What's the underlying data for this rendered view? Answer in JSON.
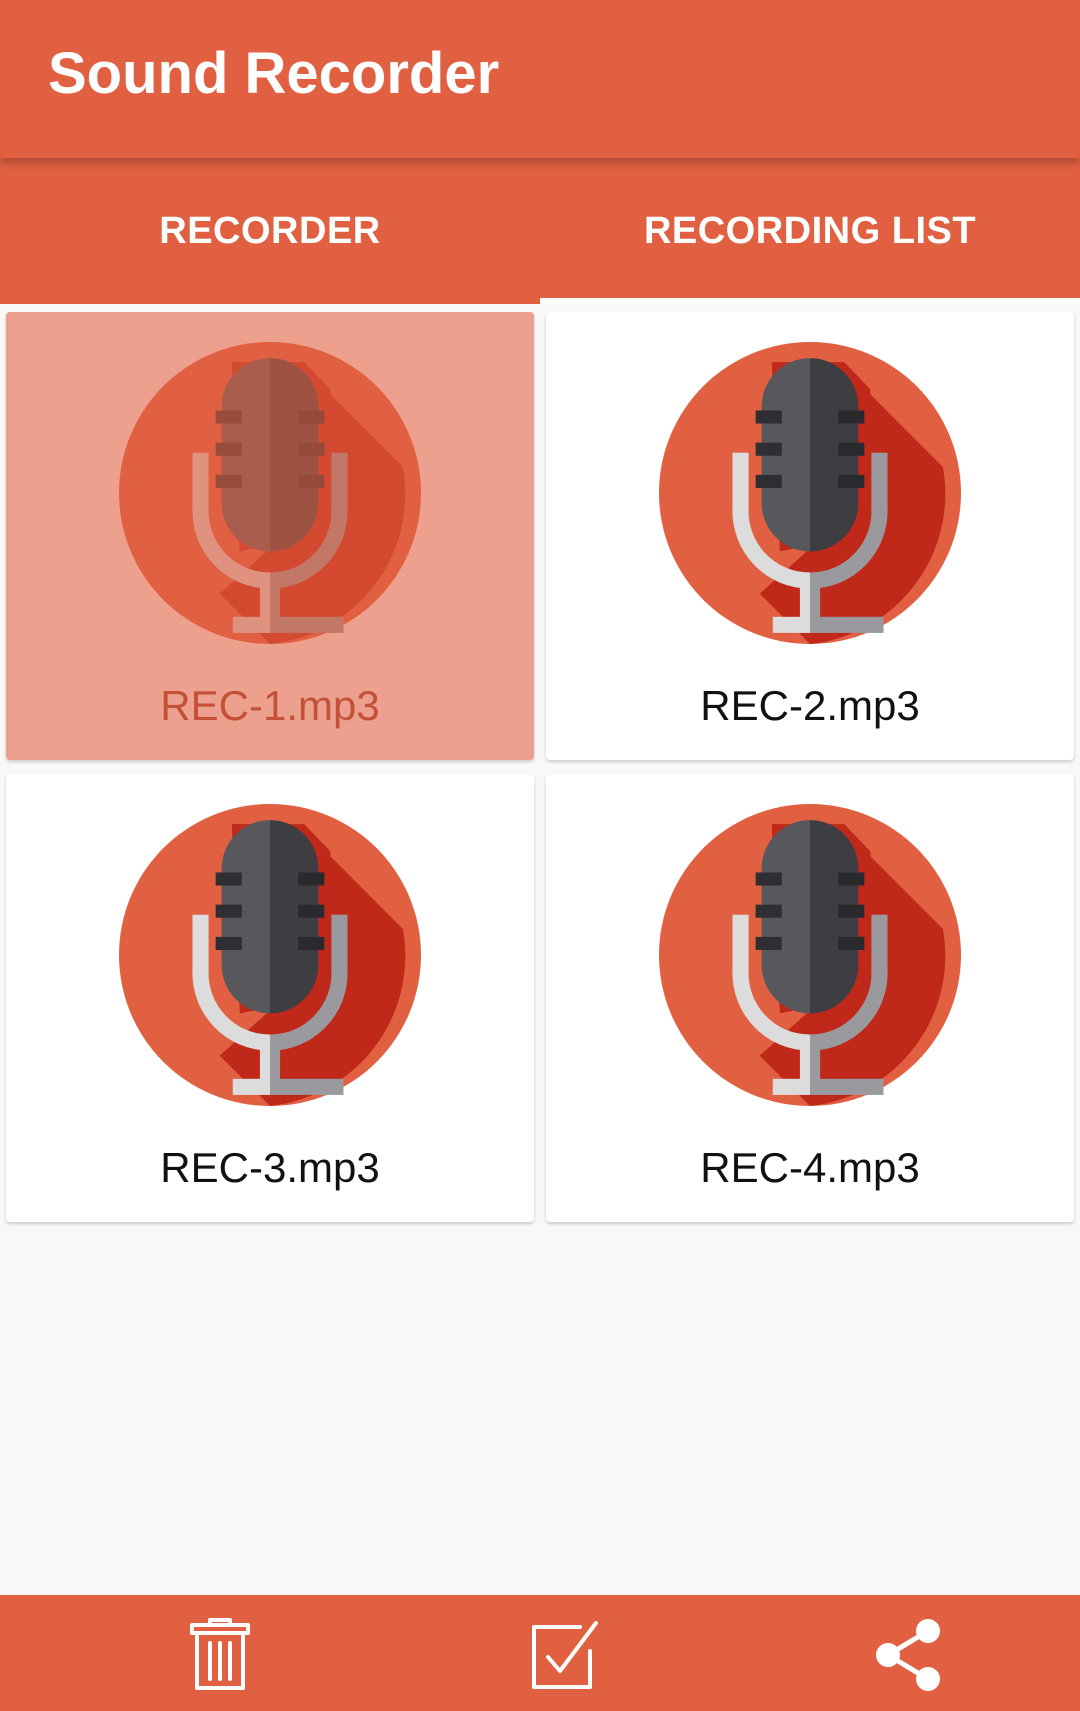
{
  "app": {
    "title": "Sound Recorder"
  },
  "tabs": [
    {
      "label": "RECORDER"
    },
    {
      "label": "RECORDING LIST"
    }
  ],
  "recordings": [
    {
      "name": "REC-1.mp3",
      "selected": true
    },
    {
      "name": "REC-2.mp3",
      "selected": false
    },
    {
      "name": "REC-3.mp3",
      "selected": false
    },
    {
      "name": "REC-4.mp3",
      "selected": false
    }
  ],
  "bottom_actions": [
    {
      "icon": "trash-icon"
    },
    {
      "icon": "checkbox-icon"
    },
    {
      "icon": "share-icon"
    }
  ],
  "colors": {
    "primary": "#e06041",
    "circle": "#e06041",
    "shadow": "#c0291a",
    "mic_dark": "#3e3e42",
    "mic_light": "#57575c",
    "stand_light": "#dcdcdc",
    "stand_dark": "#9a9a9e"
  }
}
